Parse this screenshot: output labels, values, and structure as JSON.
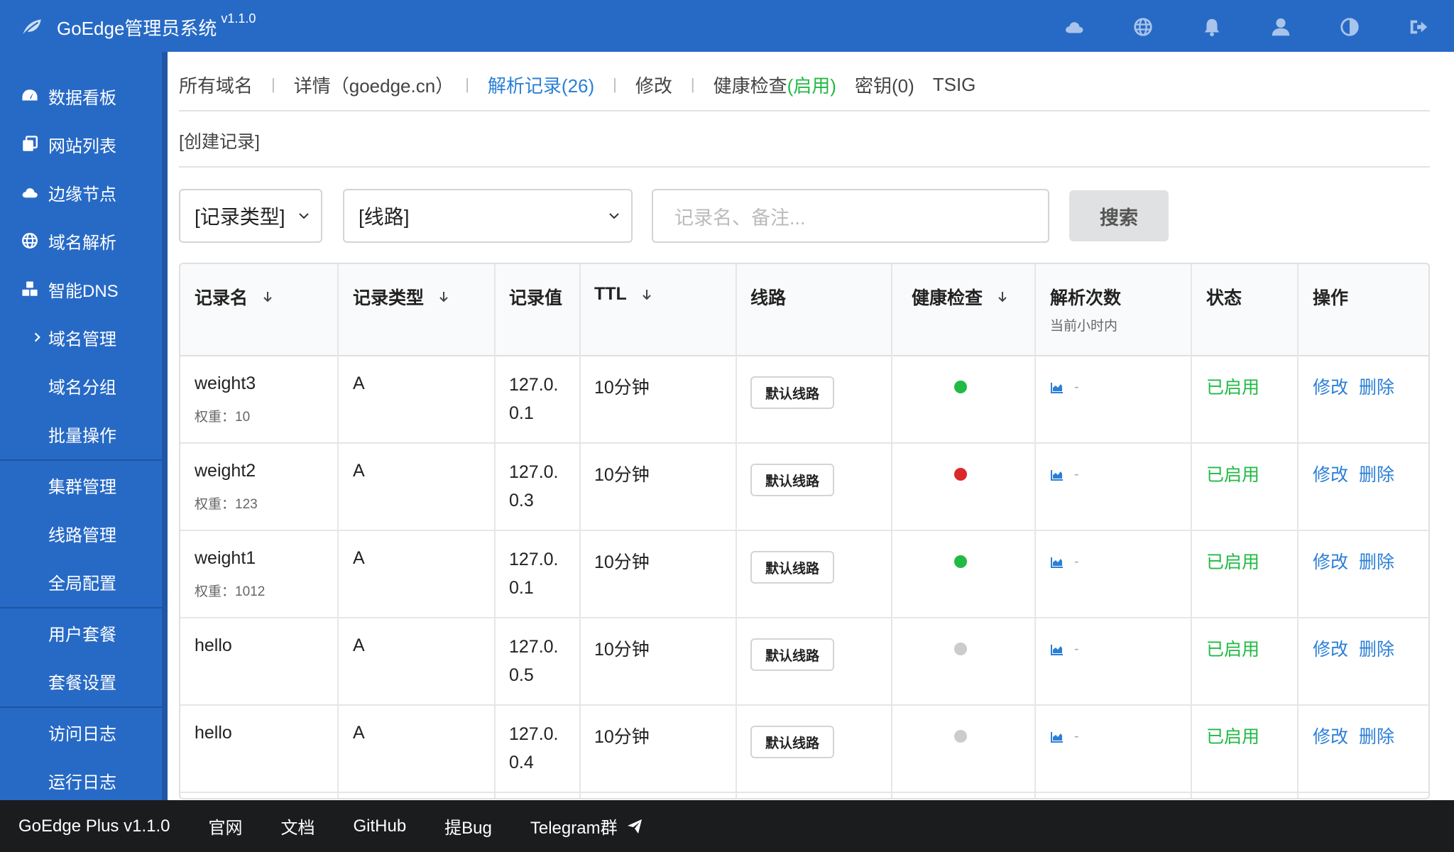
{
  "header": {
    "app_name": "GoEdge管理员系统",
    "version": "v1.1.0",
    "icons": [
      "cloud-icon",
      "globe-icon",
      "bell-icon",
      "user-icon",
      "contrast-icon",
      "logout-icon"
    ]
  },
  "sidebar": {
    "items": [
      {
        "label": "数据看板",
        "icon": "dashboard-icon"
      },
      {
        "label": "网站列表",
        "icon": "copy-icon"
      },
      {
        "label": "边缘节点",
        "icon": "cloud-icon"
      },
      {
        "label": "域名解析",
        "icon": "globe-icon"
      },
      {
        "label": "智能DNS",
        "icon": "cubes-icon"
      },
      {
        "label": "域名管理",
        "icon": "chevron-right-icon"
      },
      {
        "label": "域名分组"
      },
      {
        "label": "批量操作"
      },
      {
        "label": "集群管理"
      },
      {
        "label": "线路管理"
      },
      {
        "label": "全局配置"
      },
      {
        "label": "用户套餐"
      },
      {
        "label": "套餐设置"
      },
      {
        "label": "访问日志"
      },
      {
        "label": "运行日志"
      }
    ]
  },
  "tabs": {
    "all_domains": "所有域名",
    "detail": "详情（goedge.cn）",
    "records": "解析记录(26)",
    "edit": "修改",
    "health_prefix": "健康检查",
    "health_status": "(启用)",
    "keys": "密钥(0)",
    "tsig": "TSIG"
  },
  "create_record": "[创建记录]",
  "filters": {
    "record_type": "[记录类型]",
    "route": "[线路]",
    "search_placeholder": "记录名、备注...",
    "search_button": "搜索"
  },
  "table": {
    "headers": {
      "name": "记录名",
      "type": "记录类型",
      "value": "记录值",
      "ttl": "TTL",
      "route": "线路",
      "health": "健康检查",
      "count": "解析次数",
      "count_sub": "当前小时内",
      "status": "状态",
      "ops": "操作"
    },
    "rows": [
      {
        "name": "weight3",
        "weight": "权重：10",
        "type": "A",
        "value1": "127.0.",
        "value2": "0.1",
        "ttl": "10分钟",
        "route": "默认线路",
        "health": "#21ba45",
        "count": "-",
        "status": "已启用",
        "edit": "修改",
        "delete": "删除"
      },
      {
        "name": "weight2",
        "weight": "权重：123",
        "type": "A",
        "value1": "127.0.",
        "value2": "0.3",
        "ttl": "10分钟",
        "route": "默认线路",
        "health": "#db2828",
        "count": "-",
        "status": "已启用",
        "edit": "修改",
        "delete": "删除"
      },
      {
        "name": "weight1",
        "weight": "权重：1012",
        "type": "A",
        "value1": "127.0.",
        "value2": "0.1",
        "ttl": "10分钟",
        "route": "默认线路",
        "health": "#21ba45",
        "count": "-",
        "status": "已启用",
        "edit": "修改",
        "delete": "删除"
      },
      {
        "name": "hello",
        "weight": "",
        "type": "A",
        "value1": "127.0.",
        "value2": "0.5",
        "ttl": "10分钟",
        "route": "默认线路",
        "health": "#cccccc",
        "count": "-",
        "status": "已启用",
        "edit": "修改",
        "delete": "删除"
      },
      {
        "name": "hello",
        "weight": "",
        "type": "A",
        "value1": "127.0.",
        "value2": "0.4",
        "ttl": "10分钟",
        "route": "默认线路",
        "health": "#cccccc",
        "count": "-",
        "status": "已启用",
        "edit": "修改",
        "delete": "删除"
      }
    ]
  },
  "footer": {
    "product": "GoEdge Plus v1.1.0",
    "site": "官网",
    "docs": "文档",
    "github": "GitHub",
    "bug": "提Bug",
    "telegram": "Telegram群"
  }
}
